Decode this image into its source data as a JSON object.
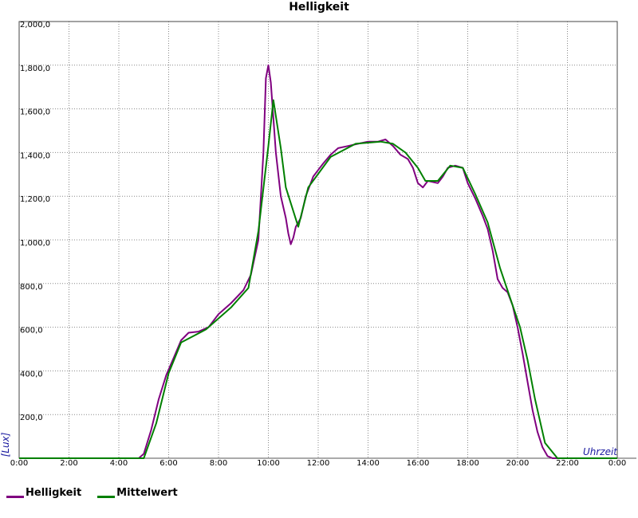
{
  "chart_data": {
    "type": "line",
    "title": "Helligkeit",
    "xlabel": "Uhrzeit",
    "ylabel": "[Lux]",
    "x_unit": "hours",
    "xlim": [
      0,
      24
    ],
    "ylim": [
      0,
      2000
    ],
    "grid": true,
    "legend_position": "bottom-left",
    "x_ticks": [
      "0:00",
      "2:00",
      "4:00",
      "6:00",
      "8:00",
      "10:00",
      "12:00",
      "14:00",
      "16:00",
      "18:00",
      "20:00",
      "22:00",
      "0:00"
    ],
    "y_ticks": [
      "0,0",
      "200,0",
      "400,0",
      "600,0",
      "800,0",
      "1,000,0",
      "1,200,0",
      "1,400,0",
      "1,600,0",
      "1,800,0",
      "2,000,0"
    ],
    "series": [
      {
        "name": "Helligkeit",
        "color": "#800080",
        "points": [
          [
            0,
            0
          ],
          [
            4.8,
            0
          ],
          [
            5.0,
            20
          ],
          [
            5.3,
            130
          ],
          [
            5.6,
            270
          ],
          [
            5.9,
            380
          ],
          [
            6.2,
            460
          ],
          [
            6.5,
            540
          ],
          [
            6.8,
            575
          ],
          [
            7.2,
            580
          ],
          [
            7.6,
            600
          ],
          [
            8.0,
            660
          ],
          [
            8.5,
            710
          ],
          [
            9.0,
            770
          ],
          [
            9.3,
            840
          ],
          [
            9.6,
            1000
          ],
          [
            9.8,
            1400
          ],
          [
            9.9,
            1740
          ],
          [
            10.0,
            1800
          ],
          [
            10.1,
            1720
          ],
          [
            10.3,
            1400
          ],
          [
            10.5,
            1200
          ],
          [
            10.7,
            1100
          ],
          [
            10.8,
            1030
          ],
          [
            10.9,
            980
          ],
          [
            11.0,
            1010
          ],
          [
            11.1,
            1060
          ],
          [
            11.3,
            1100
          ],
          [
            11.5,
            1200
          ],
          [
            11.8,
            1290
          ],
          [
            12.0,
            1320
          ],
          [
            12.2,
            1350
          ],
          [
            12.5,
            1390
          ],
          [
            12.8,
            1420
          ],
          [
            13.2,
            1430
          ],
          [
            13.6,
            1440
          ],
          [
            14.0,
            1450
          ],
          [
            14.4,
            1450
          ],
          [
            14.7,
            1460
          ],
          [
            15.0,
            1430
          ],
          [
            15.3,
            1390
          ],
          [
            15.6,
            1370
          ],
          [
            15.8,
            1330
          ],
          [
            16.0,
            1260
          ],
          [
            16.2,
            1240
          ],
          [
            16.4,
            1270
          ],
          [
            16.8,
            1260
          ],
          [
            17.0,
            1290
          ],
          [
            17.2,
            1330
          ],
          [
            17.5,
            1340
          ],
          [
            17.8,
            1330
          ],
          [
            18.0,
            1260
          ],
          [
            18.3,
            1190
          ],
          [
            18.6,
            1110
          ],
          [
            18.8,
            1050
          ],
          [
            19.0,
            950
          ],
          [
            19.2,
            820
          ],
          [
            19.4,
            780
          ],
          [
            19.6,
            760
          ],
          [
            19.8,
            700
          ],
          [
            20.0,
            600
          ],
          [
            20.2,
            480
          ],
          [
            20.4,
            350
          ],
          [
            20.6,
            220
          ],
          [
            20.8,
            120
          ],
          [
            21.0,
            50
          ],
          [
            21.2,
            10
          ],
          [
            21.4,
            0
          ],
          [
            24,
            0
          ]
        ]
      },
      {
        "name": "Mittelwert",
        "color": "#008000",
        "points": [
          [
            0,
            0
          ],
          [
            5.0,
            0
          ],
          [
            5.5,
            160
          ],
          [
            6.0,
            390
          ],
          [
            6.5,
            530
          ],
          [
            7.5,
            590
          ],
          [
            8.5,
            690
          ],
          [
            9.2,
            780
          ],
          [
            9.6,
            1040
          ],
          [
            10.0,
            1430
          ],
          [
            10.2,
            1640
          ],
          [
            10.5,
            1420
          ],
          [
            10.7,
            1240
          ],
          [
            11.2,
            1060
          ],
          [
            11.6,
            1240
          ],
          [
            12.5,
            1380
          ],
          [
            13.5,
            1440
          ],
          [
            14.5,
            1450
          ],
          [
            15.0,
            1440
          ],
          [
            15.5,
            1400
          ],
          [
            16.0,
            1330
          ],
          [
            16.3,
            1270
          ],
          [
            16.8,
            1270
          ],
          [
            17.3,
            1340
          ],
          [
            17.8,
            1330
          ],
          [
            18.3,
            1210
          ],
          [
            18.8,
            1080
          ],
          [
            19.3,
            870
          ],
          [
            19.8,
            700
          ],
          [
            20.1,
            600
          ],
          [
            20.4,
            450
          ],
          [
            20.7,
            270
          ],
          [
            21.1,
            70
          ],
          [
            21.6,
            0
          ],
          [
            24,
            0
          ]
        ]
      }
    ]
  }
}
